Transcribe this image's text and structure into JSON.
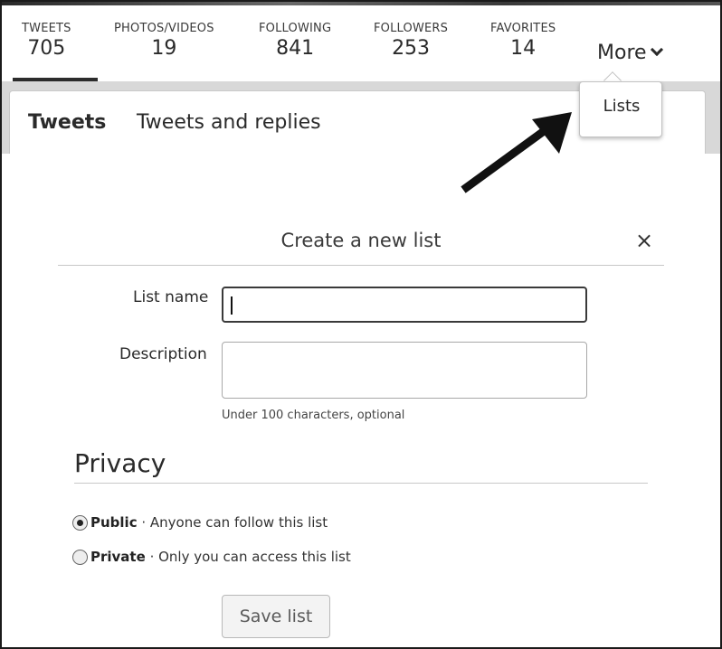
{
  "profile_nav": {
    "stats": [
      {
        "label": "TWEETS",
        "value": "705"
      },
      {
        "label": "PHOTOS/VIDEOS",
        "value": "19"
      },
      {
        "label": "FOLLOWING",
        "value": "841"
      },
      {
        "label": "FOLLOWERS",
        "value": "253"
      },
      {
        "label": "FAVORITES",
        "value": "14"
      }
    ],
    "more_label": "More"
  },
  "more_dropdown": {
    "items": [
      {
        "label": "Lists"
      }
    ]
  },
  "timeline_tabs": [
    {
      "label": "Tweets"
    },
    {
      "label": "Tweets and replies"
    }
  ],
  "modal": {
    "title": "Create a new list",
    "close_label": "×",
    "list_name_label": "List name",
    "list_name_value": "",
    "description_label": "Description",
    "description_value": "",
    "description_hint": "Under 100 characters, optional",
    "privacy_heading": "Privacy",
    "privacy_options": [
      {
        "label": "Public",
        "detail": "· Anyone can follow this list",
        "selected": true
      },
      {
        "label": "Private",
        "detail": "· Only you can access this list",
        "selected": false
      }
    ],
    "save_label": "Save list"
  }
}
